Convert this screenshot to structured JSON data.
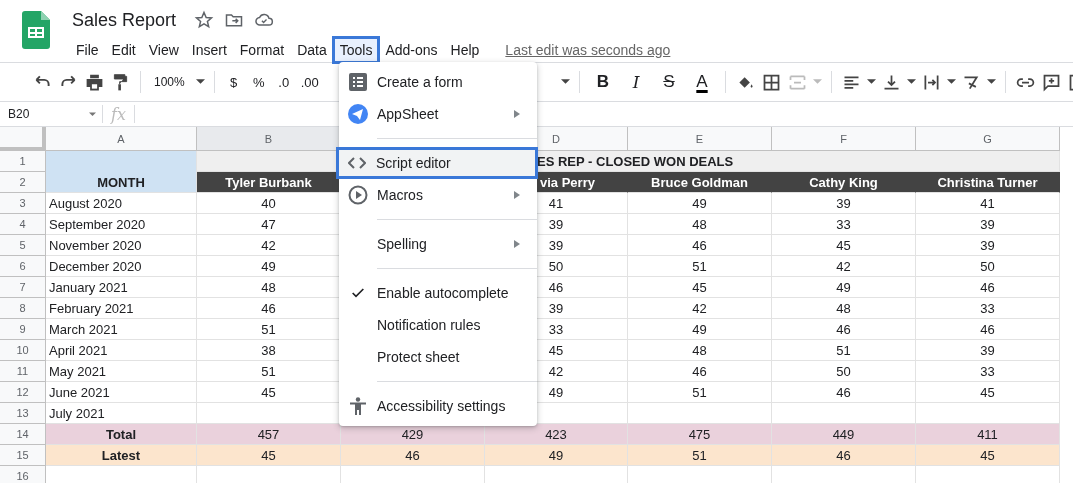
{
  "document": {
    "title": "Sales Report",
    "last_edit": "Last edit was seconds ago"
  },
  "menus": [
    {
      "label": "File",
      "selected": false
    },
    {
      "label": "Edit",
      "selected": false
    },
    {
      "label": "View",
      "selected": false
    },
    {
      "label": "Insert",
      "selected": false
    },
    {
      "label": "Format",
      "selected": false
    },
    {
      "label": "Data",
      "selected": false
    },
    {
      "label": "Tools",
      "selected": true
    },
    {
      "label": "Add-ons",
      "selected": false
    },
    {
      "label": "Help",
      "selected": false
    }
  ],
  "toolbar": {
    "zoom": "100%",
    "number_buttons": [
      "$",
      "%",
      ".0",
      ".00"
    ],
    "text_buttons": [
      "B",
      "I",
      "S",
      "A"
    ]
  },
  "formula_bar": {
    "name_box": "B20",
    "fx": "fx"
  },
  "sheet": {
    "columns_left": [
      "A",
      "B"
    ],
    "columns_right": [
      "D",
      "E",
      "F",
      "G"
    ],
    "title_row": {
      "row": "1",
      "text": "ES REP - CLOSED WON DEALS"
    },
    "header_row": {
      "row": "2",
      "month": "MONTH",
      "column_b": "Tyler Burbank",
      "columns_d_to_g": [
        "via Perry",
        "Bruce Goldman",
        "Cathy King",
        "Christina Turner"
      ]
    },
    "rows": [
      {
        "row": "3",
        "kind": "data",
        "month": "August 2020",
        "column_b": "40",
        "columns_d_to_g": [
          "41",
          "49",
          "39",
          "41"
        ]
      },
      {
        "row": "4",
        "kind": "data",
        "month": "September 2020",
        "column_b": "47",
        "columns_d_to_g": [
          "39",
          "48",
          "33",
          "39"
        ]
      },
      {
        "row": "5",
        "kind": "data",
        "month": "November 2020",
        "column_b": "42",
        "columns_d_to_g": [
          "39",
          "46",
          "45",
          "39"
        ]
      },
      {
        "row": "6",
        "kind": "data",
        "month": "December 2020",
        "column_b": "49",
        "columns_d_to_g": [
          "50",
          "51",
          "42",
          "50"
        ]
      },
      {
        "row": "7",
        "kind": "data",
        "month": "January 2021",
        "column_b": "48",
        "columns_d_to_g": [
          "46",
          "45",
          "49",
          "46"
        ]
      },
      {
        "row": "8",
        "kind": "data",
        "month": "February 2021",
        "column_b": "46",
        "columns_d_to_g": [
          "39",
          "42",
          "48",
          "33"
        ]
      },
      {
        "row": "9",
        "kind": "data",
        "month": "March 2021",
        "column_b": "51",
        "columns_d_to_g": [
          "33",
          "49",
          "46",
          "46"
        ]
      },
      {
        "row": "10",
        "kind": "data",
        "month": "April 2021",
        "column_b": "38",
        "columns_d_to_g": [
          "45",
          "48",
          "51",
          "39"
        ]
      },
      {
        "row": "11",
        "kind": "data",
        "month": "May 2021",
        "column_b": "51",
        "columns_d_to_g": [
          "42",
          "46",
          "50",
          "33"
        ]
      },
      {
        "row": "12",
        "kind": "data",
        "month": "June 2021",
        "column_b": "45",
        "columns_d_to_g": [
          "49",
          "51",
          "46",
          "45"
        ]
      },
      {
        "row": "13",
        "kind": "data",
        "month": "July 2021"
      },
      {
        "row": "14",
        "kind": "total",
        "month": "Total",
        "column_b": "457",
        "column_c": "429",
        "columns_d_to_g": [
          "423",
          "475",
          "449",
          "411"
        ]
      },
      {
        "row": "15",
        "kind": "latest",
        "month": "Latest",
        "column_b": "45",
        "column_c": "46",
        "columns_d_to_g": [
          "49",
          "51",
          "46",
          "45"
        ]
      },
      {
        "row": "16"
      }
    ]
  },
  "tools_menu": [
    {
      "kind": "form",
      "label": "Create a form",
      "submenu": false,
      "checked": false,
      "selected": false
    },
    {
      "kind": "appsheet",
      "label": "AppSheet",
      "submenu": true,
      "checked": false,
      "selected": false
    },
    {
      "kind": "separator"
    },
    {
      "kind": "code",
      "label": "Script editor",
      "submenu": false,
      "checked": false,
      "selected": true
    },
    {
      "kind": "macro",
      "label": "Macros",
      "submenu": true,
      "checked": false,
      "selected": false
    },
    {
      "kind": "separator"
    },
    {
      "kind": "plain",
      "label": "Spelling",
      "submenu": true,
      "checked": false,
      "selected": false
    },
    {
      "kind": "separator"
    },
    {
      "kind": "plain",
      "label": "Enable autocomplete",
      "submenu": false,
      "checked": true,
      "selected": false
    },
    {
      "kind": "plain",
      "label": "Notification rules",
      "submenu": false,
      "checked": false,
      "selected": false
    },
    {
      "kind": "plain",
      "label": "Protect sheet",
      "submenu": false,
      "checked": false,
      "selected": false
    },
    {
      "kind": "separator"
    },
    {
      "kind": "accessibility",
      "label": "Accessibility settings",
      "submenu": false,
      "checked": false,
      "selected": false
    }
  ]
}
